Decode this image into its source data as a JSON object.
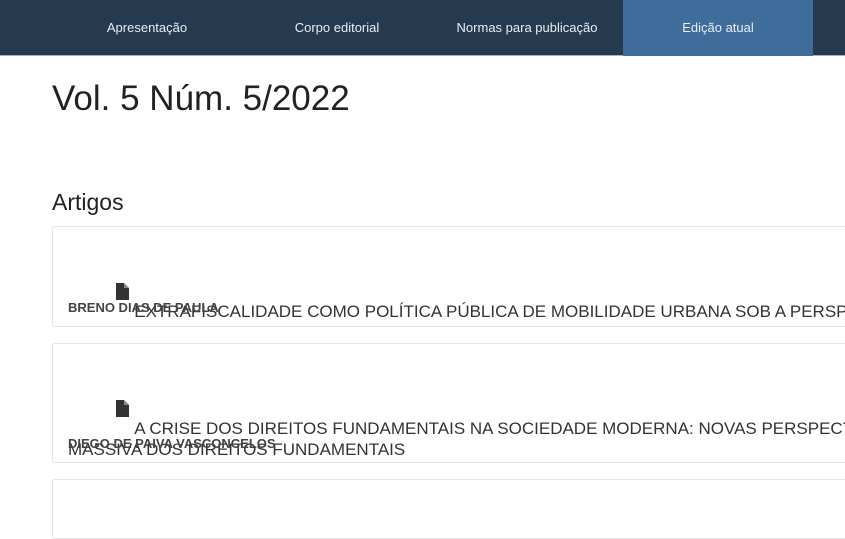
{
  "nav": {
    "items": [
      {
        "label": "Apresentação"
      },
      {
        "label": "Corpo editorial"
      },
      {
        "label": "Normas para publicação"
      },
      {
        "label": "Edição atual"
      }
    ],
    "active_index": 3
  },
  "issue": {
    "title": "Vol. 5 Núm. 5/2022"
  },
  "section": {
    "title": "Artigos"
  },
  "articles": [
    {
      "title": "EXTRAFISCALIDADE COMO POLÍTICA PÚBLICA DE MOBILIDADE URBANA SOB A PERSPE",
      "author": "BRENO DIAS DE PAULA"
    },
    {
      "title": "A CRISE DOS DIREITOS FUNDAMENTAIS NA SOCIEDADE MODERNA: NOVAS PERSPECTI\nMASSIVA DOS DIREITOS FUNDAMENTAIS",
      "author": "DIEGO DE PAIVA VASCONCELOS"
    }
  ],
  "colors": {
    "navbar": "#253a4f",
    "nav_active": "#3f6d9b",
    "text": "#222222"
  },
  "icons": {
    "article": "file-icon"
  }
}
